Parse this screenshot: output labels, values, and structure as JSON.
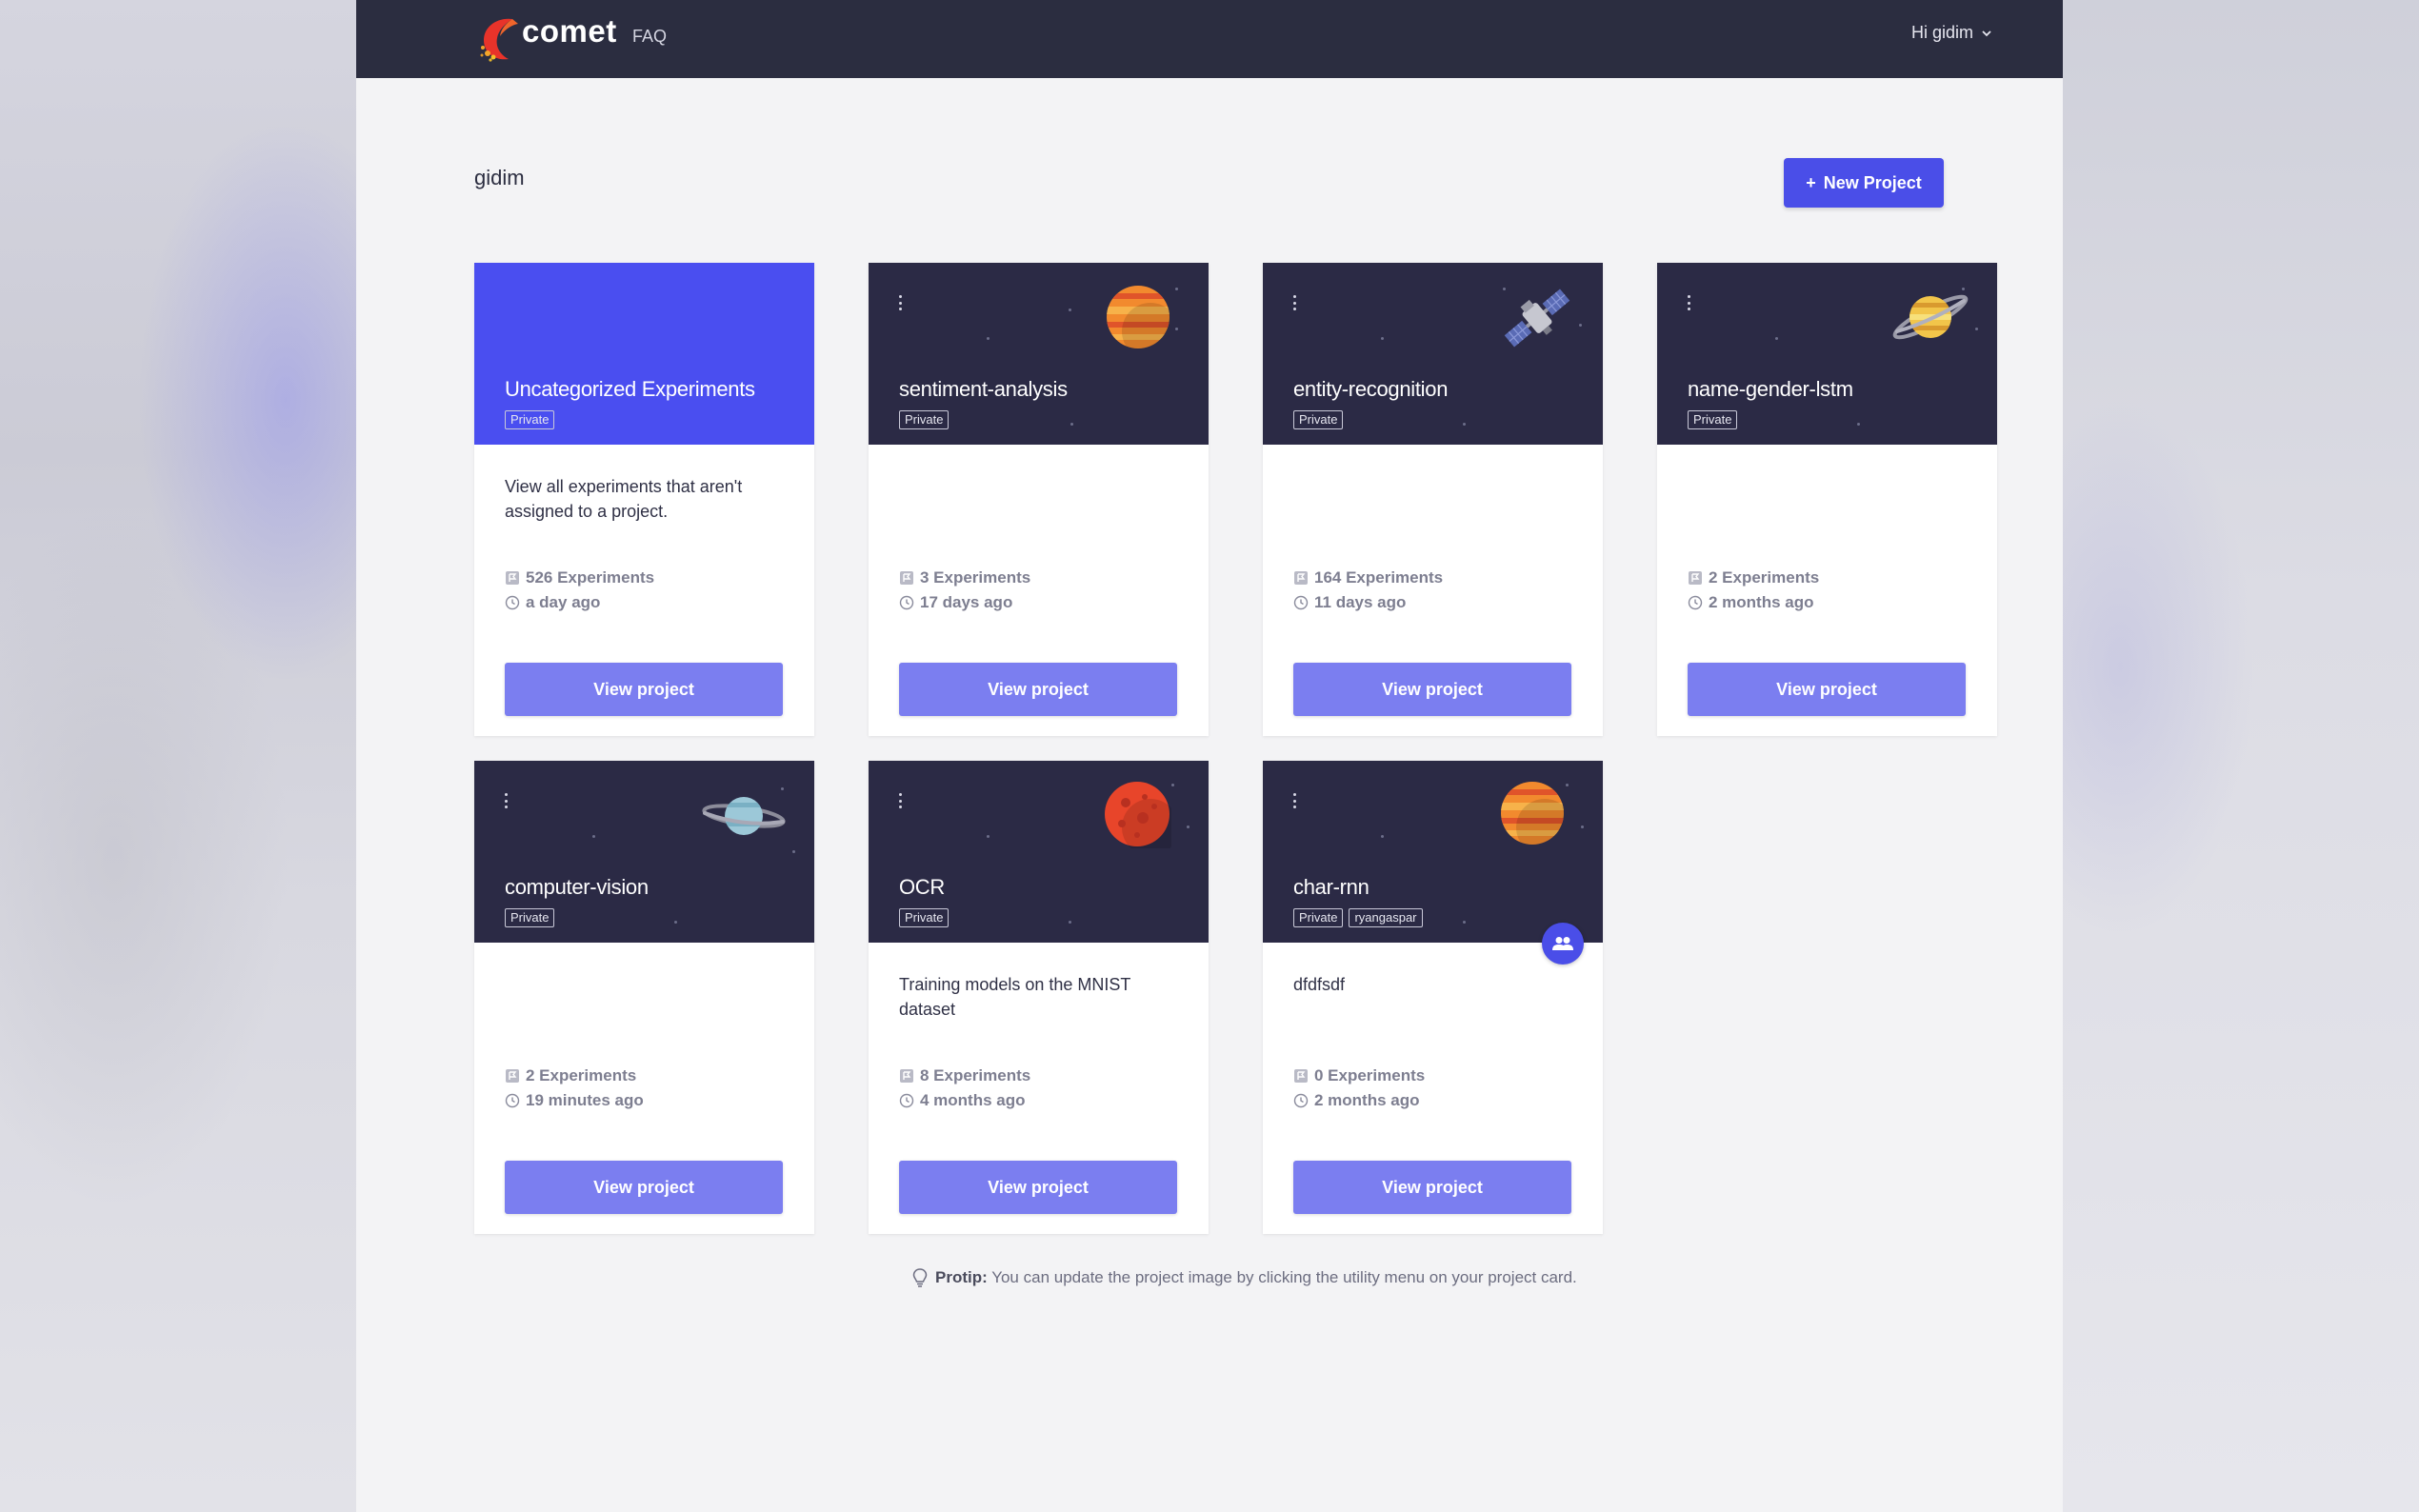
{
  "header": {
    "brand": "comet",
    "faq_label": "FAQ",
    "user_label": "Hi gidim"
  },
  "page": {
    "owner": "gidim",
    "new_project_label": "New Project"
  },
  "projects": [
    {
      "title": "Uncategorized Experiments",
      "tags": [
        "Private"
      ],
      "description": "View all experiments that aren't assigned to a project.",
      "experiments": "526 Experiments",
      "updated": "a day ago",
      "button": "View project",
      "image": "none"
    },
    {
      "title": "sentiment-analysis",
      "tags": [
        "Private"
      ],
      "description": "",
      "experiments": "3 Experiments",
      "updated": "17 days ago",
      "button": "View project",
      "image": "orange-planet-icon"
    },
    {
      "title": "entity-recognition",
      "tags": [
        "Private"
      ],
      "description": "",
      "experiments": "164 Experiments",
      "updated": "11 days ago",
      "button": "View project",
      "image": "satellite-icon"
    },
    {
      "title": "name-gender-lstm",
      "tags": [
        "Private"
      ],
      "description": "",
      "experiments": "2 Experiments",
      "updated": "2 months ago",
      "button": "View project",
      "image": "ringed-planet-icon"
    },
    {
      "title": "computer-vision",
      "tags": [
        "Private"
      ],
      "description": "",
      "experiments": "2 Experiments",
      "updated": "19 minutes ago",
      "button": "View project",
      "image": "blue-ringed-planet-icon"
    },
    {
      "title": "OCR",
      "tags": [
        "Private"
      ],
      "description": "Training models on the MNIST dataset",
      "experiments": "8 Experiments",
      "updated": "4 months ago",
      "button": "View project",
      "image": "red-planet-icon"
    },
    {
      "title": "char-rnn",
      "tags": [
        "Private",
        "ryangaspar"
      ],
      "description": "dfdfsdf",
      "experiments": "0 Experiments",
      "updated": "2 months ago",
      "button": "View project",
      "image": "orange-planet-icon",
      "shared": true
    }
  ],
  "protip": {
    "label": "Protip:",
    "text": "You can update the project image by clicking the utility menu on your project card."
  },
  "colors": {
    "topbar": "#2b2d40",
    "accent": "#4a4ee8",
    "card_header": "#2b2a45",
    "view_button": "#7b7ef0"
  }
}
